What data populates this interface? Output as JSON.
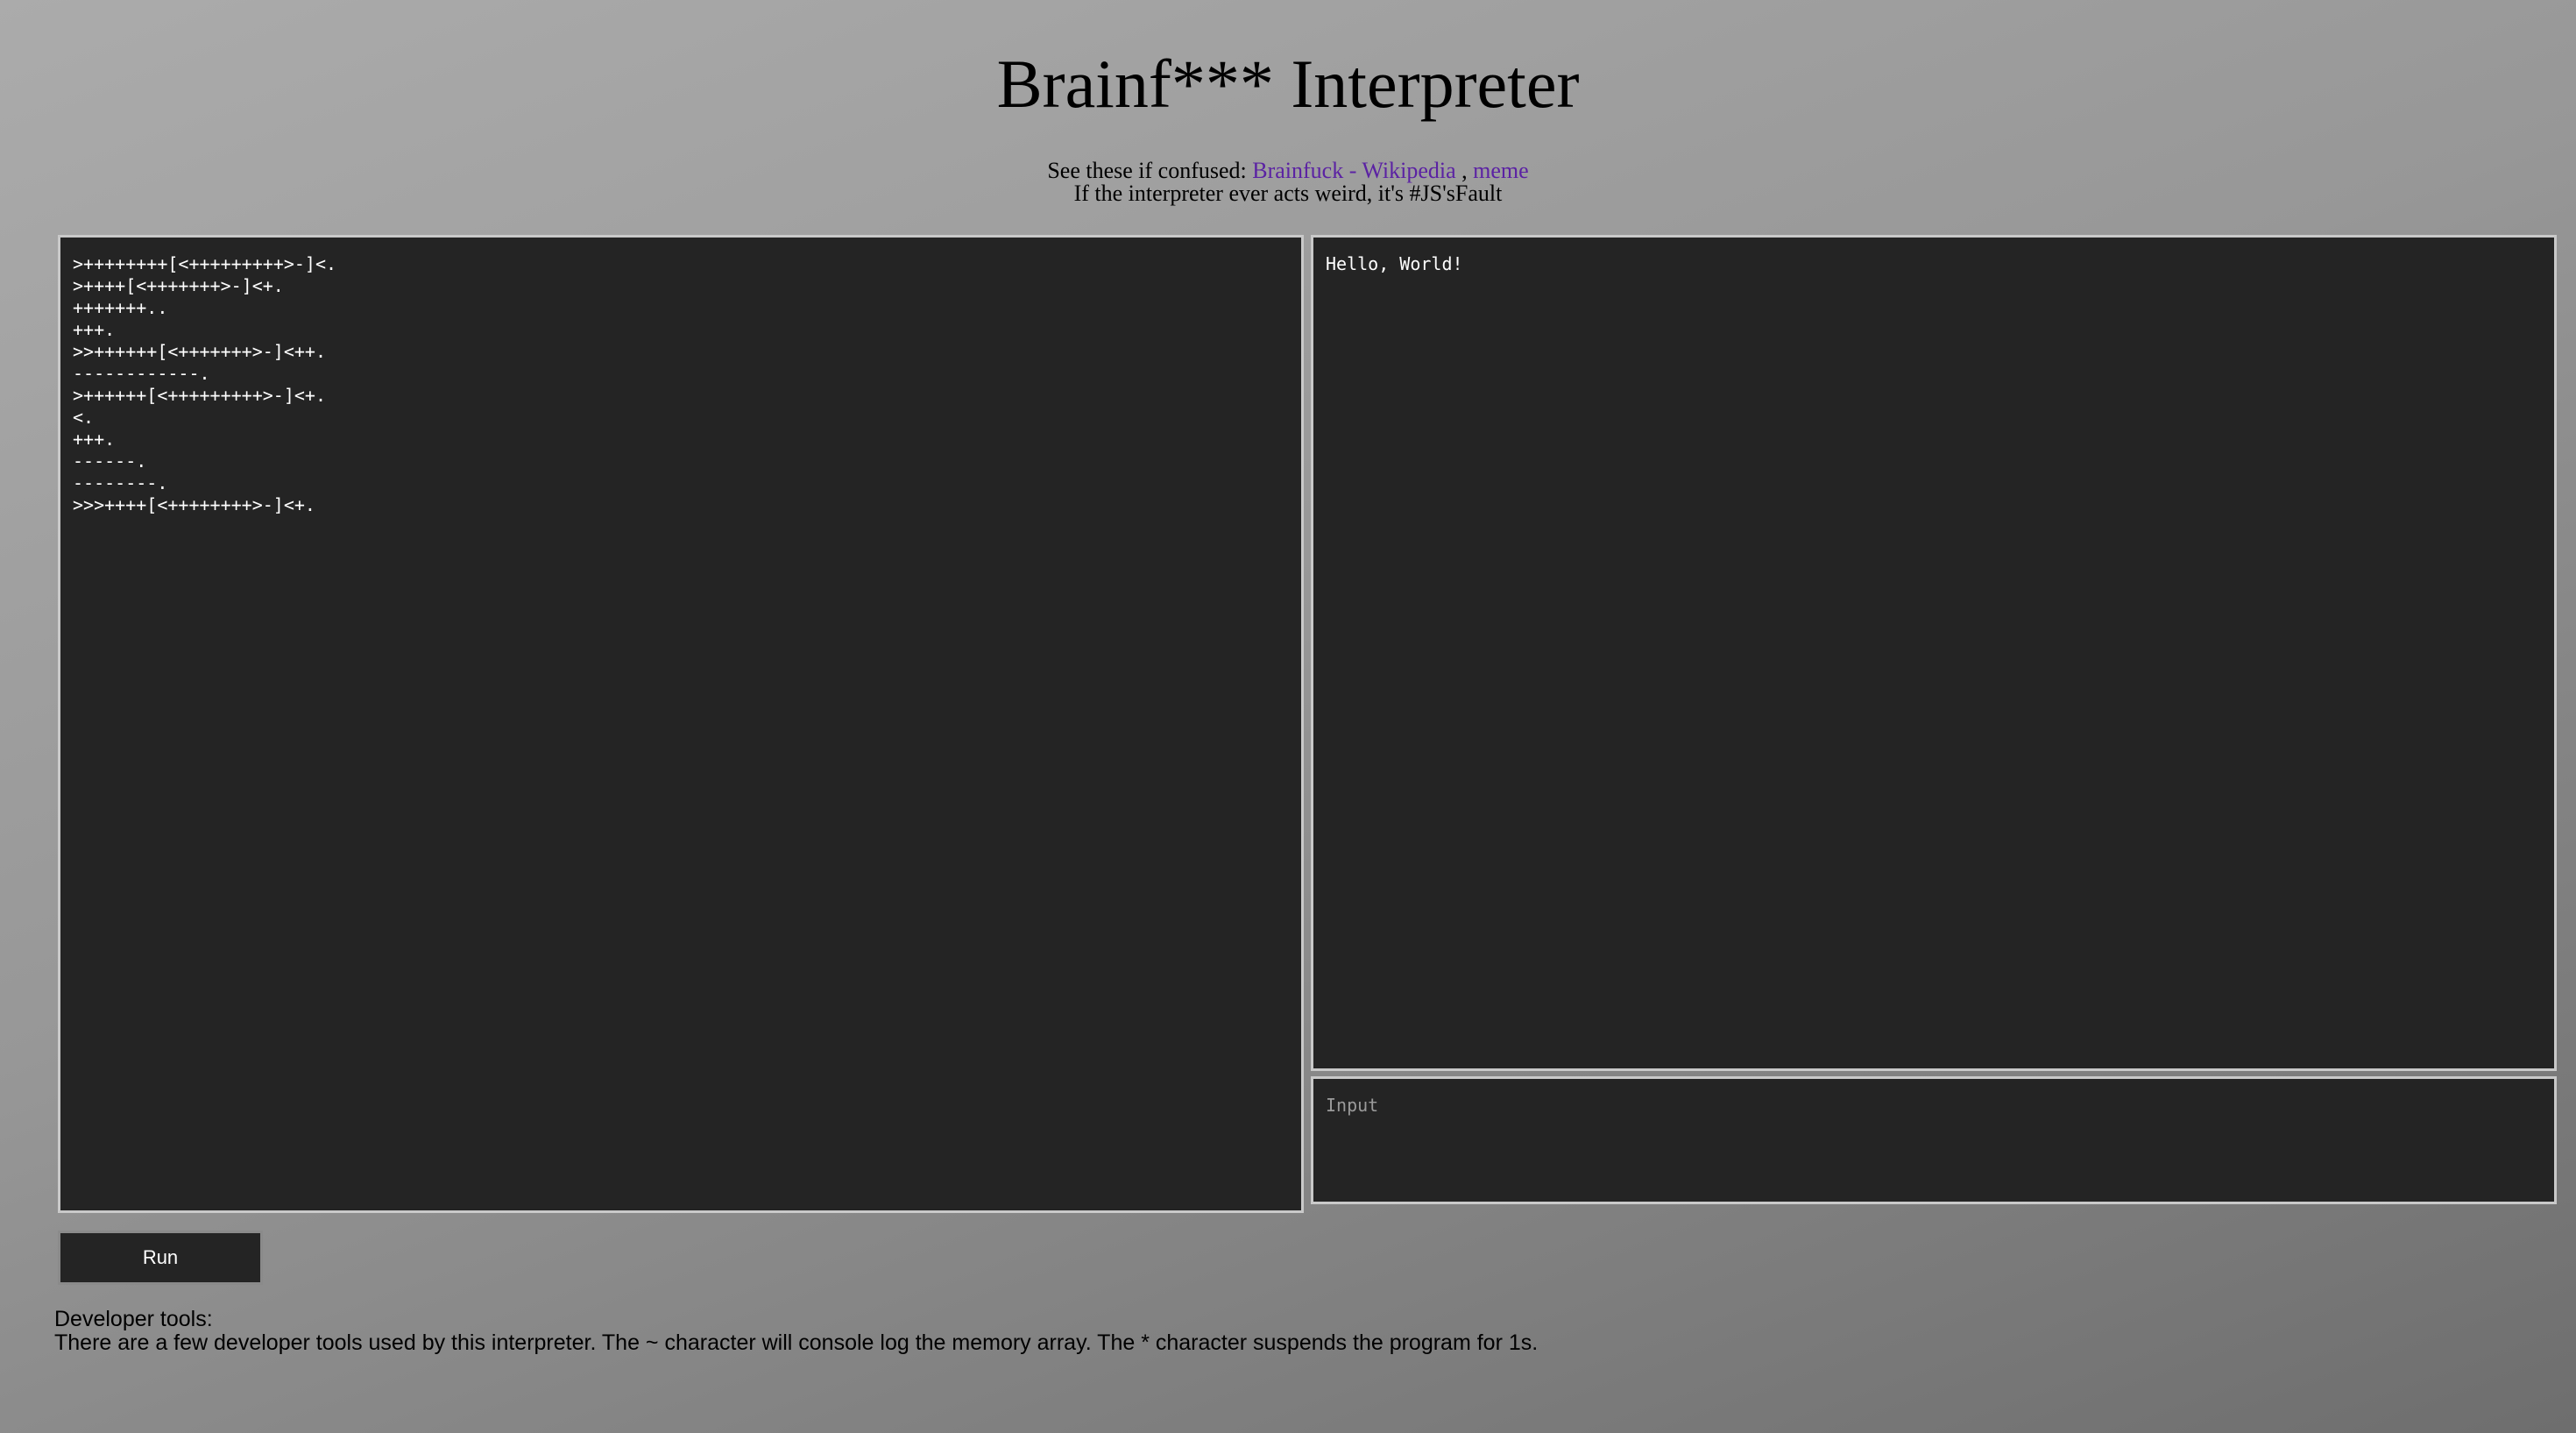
{
  "header": {
    "title": "Brainf*** Interpreter"
  },
  "info": {
    "see_prefix": "See these if confused: ",
    "wiki_link": "Brainfuck - Wikipedia",
    "separator": " , ",
    "meme_link": "meme",
    "warning": "If the interpreter ever acts weird, it's #JS'sFault"
  },
  "editor": {
    "code": ">++++++++[<+++++++++>-]<.\n>++++[<+++++++>-]<+.\n+++++++..\n+++.\n>>++++++[<+++++++>-]<++.\n------------.\n>++++++[<+++++++++>-]<+.\n<.\n+++.\n------.\n--------.\n>>>++++[<++++++++>-]<+."
  },
  "output": {
    "text": "Hello, World!"
  },
  "input": {
    "placeholder": "Input",
    "value": ""
  },
  "controls": {
    "run_label": "Run"
  },
  "dev_tools": {
    "heading": "Developer tools:",
    "description": "There are a few developer tools used by this interpreter. The ~ character will console log the memory array. The * character suspends the program for 1s."
  },
  "colors": {
    "panel_background": "#242424",
    "link": "#5b22a3",
    "panel_text": "#ffffff"
  }
}
